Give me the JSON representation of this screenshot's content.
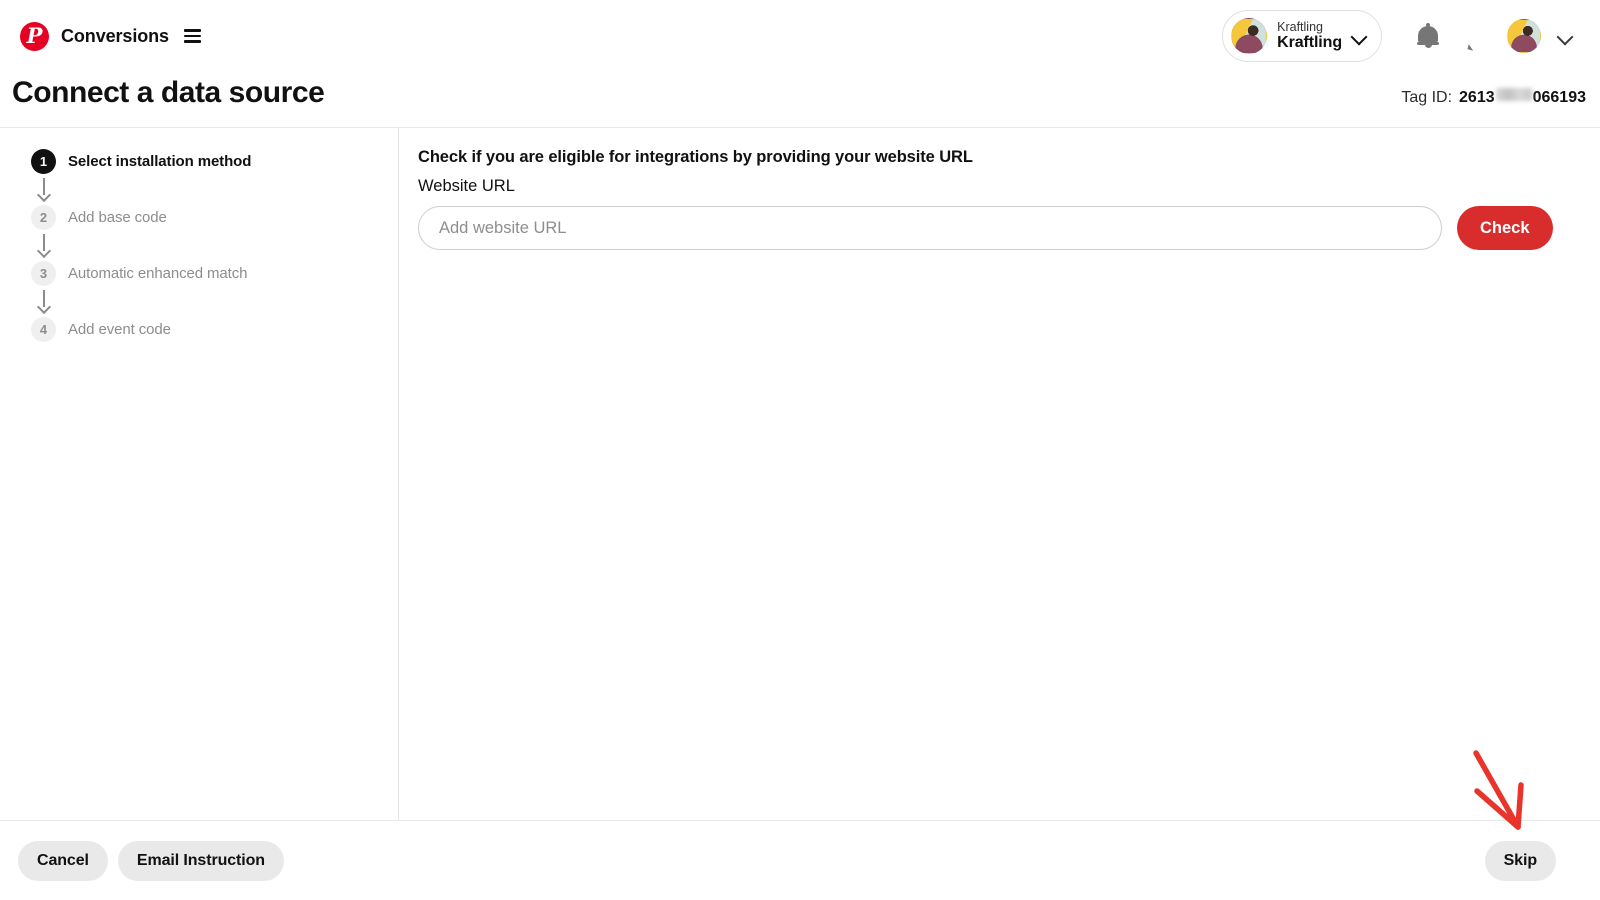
{
  "topnav": {
    "brand_title": "Conversions",
    "logo_glyph": "P",
    "menu_icon": "hamburger-menu-icon",
    "account": {
      "sub_label": "Kraftling",
      "name": "Kraftling",
      "chevron_icon": "chevron-down-icon"
    },
    "notifications_icon": "bell-icon",
    "messages_icon": "chat-bubble-icon",
    "profile_avatar": "user-avatar",
    "profile_chevron_icon": "chevron-down-icon"
  },
  "header": {
    "title": "Connect a data source",
    "tag_id_label": "Tag ID:",
    "tag_id_prefix": "2613",
    "tag_id_suffix": "066193"
  },
  "steps": [
    {
      "number": "1",
      "label": "Select installation method",
      "active": true
    },
    {
      "number": "2",
      "label": "Add base code",
      "active": false
    },
    {
      "number": "3",
      "label": "Automatic enhanced match",
      "active": false
    },
    {
      "number": "4",
      "label": "Add event code",
      "active": false
    }
  ],
  "main": {
    "heading": "Check if you are eligible for integrations by providing your website URL",
    "field_label": "Website URL",
    "url_value": "",
    "url_placeholder": "Add website URL",
    "check_label": "Check"
  },
  "footer": {
    "cancel_label": "Cancel",
    "email_instruction_label": "Email Instruction",
    "skip_label": "Skip"
  },
  "annotation": {
    "type": "hand-drawn-arrow",
    "color": "#e8342a",
    "points_to": "skip-button"
  },
  "colors": {
    "brand_red": "#e60023",
    "check_red": "#d92d2d",
    "annotation_red": "#e8342a",
    "active_step": "#111111",
    "inactive_step": "#8d8d8d",
    "gray_button": "#e9e9e9"
  }
}
